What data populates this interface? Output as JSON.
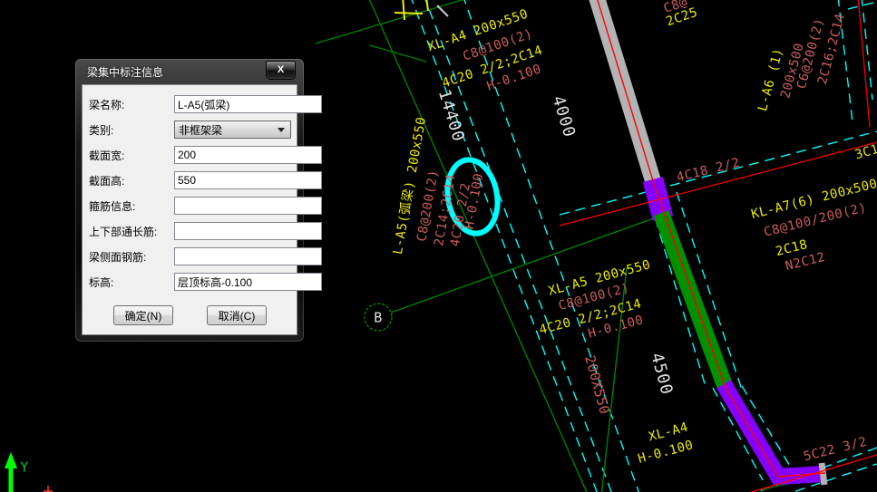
{
  "dialog": {
    "title": "梁集中标注信息",
    "close_icon": "X",
    "fields": [
      {
        "label": "梁名称:",
        "value": "L-A5(弧梁)"
      },
      {
        "label": "类别:",
        "value": "非框架梁"
      },
      {
        "label": "截面宽:",
        "value": "200"
      },
      {
        "label": "截面高:",
        "value": "550"
      },
      {
        "label": "箍筋信息:",
        "value": ""
      },
      {
        "label": "上下部通长筋:",
        "value": ""
      },
      {
        "label": "梁侧面钢筋:",
        "value": ""
      },
      {
        "label": "标高:",
        "value": "层顶标高-0.100"
      }
    ],
    "ok_label": "确定(N)",
    "cancel_label": "取消(C)"
  },
  "drawing": {
    "grid_bubble_label": "B",
    "ucs_y_label": "Y",
    "labels": [
      {
        "text": "XL-A4 200x550",
        "color": "yellow"
      },
      {
        "text": "C8@100(2)",
        "color": "red"
      },
      {
        "text": "4C20 2/2;2C14",
        "color": "yellow"
      },
      {
        "text": "H-0.100",
        "color": "red"
      },
      {
        "text": "L-A5(弧梁) 200x550",
        "color": "yellow"
      },
      {
        "text": "C8@200(2)",
        "color": "red"
      },
      {
        "text": "2C14;2C14",
        "color": "red"
      },
      {
        "text": "4C20 2/2",
        "color": "red"
      },
      {
        "text": "H-0.100",
        "color": "red"
      },
      {
        "text": "14400",
        "color": "white"
      },
      {
        "text": "4000",
        "color": "white"
      },
      {
        "text": "C8@",
        "color": "red"
      },
      {
        "text": "2C25",
        "color": "yellow"
      },
      {
        "text": "L-A6 (1)",
        "color": "yellow"
      },
      {
        "text": "200x500",
        "color": "red"
      },
      {
        "text": "C6@200(2)",
        "color": "red"
      },
      {
        "text": "2C16;2C14",
        "color": "red"
      },
      {
        "text": "3C1",
        "color": "yellow"
      },
      {
        "text": "4C18 2/2",
        "color": "red"
      },
      {
        "text": "KL-A7(6) 200x500",
        "color": "yellow"
      },
      {
        "text": "C8@100/200(2)",
        "color": "red"
      },
      {
        "text": "2C18",
        "color": "yellow"
      },
      {
        "text": "N2C12",
        "color": "red"
      },
      {
        "text": "XL-A5 200x550",
        "color": "yellow"
      },
      {
        "text": "C8@100(2)",
        "color": "red"
      },
      {
        "text": "4C20 2/2;2C14",
        "color": "yellow"
      },
      {
        "text": "H-0.100",
        "color": "red"
      },
      {
        "text": "200X550",
        "color": "red"
      },
      {
        "text": "4500",
        "color": "white"
      },
      {
        "text": "XL-A4",
        "color": "yellow"
      },
      {
        "text": "H-0.100",
        "color": "yellow"
      },
      {
        "text": "5C22 3/2",
        "color": "red"
      }
    ],
    "colors": {
      "background": "#000000",
      "annotation_yellow": "#ecec00",
      "annotation_red": "#cd5c5c",
      "dimension_white": "#e2e2e2",
      "construction_cyan": "#00ffff",
      "grid_green": "#008000",
      "centerline_red": "#ff0000",
      "beam_gray": "#b3b3b3",
      "beam_purple": "#8400ff",
      "beam_green": "#009000",
      "ucs_green": "#00ff00"
    }
  }
}
